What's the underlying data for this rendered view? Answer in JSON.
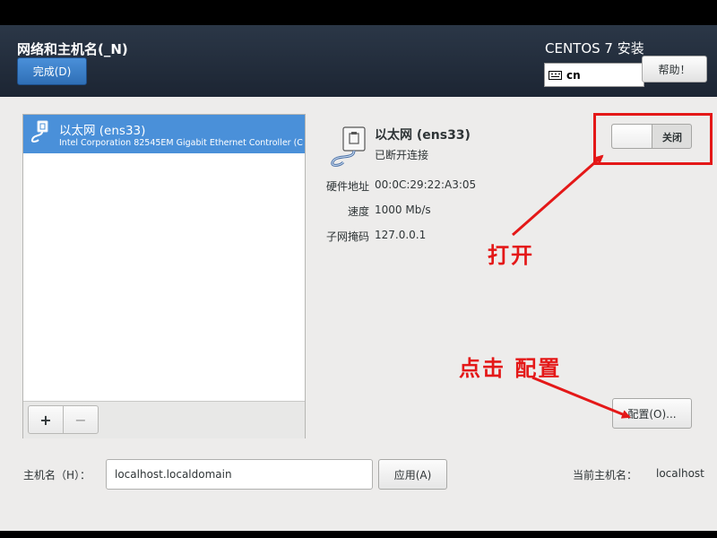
{
  "header": {
    "title": "网络和主机名(_N)",
    "done_label": "完成(D)",
    "installer_title": "CENTOS 7 安装",
    "keyboard_layout": "cn",
    "help_label": "帮助！"
  },
  "connections": {
    "items": [
      {
        "name": "以太网 (ens33)",
        "description": "Intel Corporation 82545EM Gigabit Ethernet Controller (C",
        "selected": true
      }
    ],
    "add_label": "+",
    "remove_label": "−"
  },
  "detail": {
    "name": "以太网 (ens33)",
    "status": "已断开连接",
    "properties": [
      {
        "label": "硬件地址",
        "value": "00:0C:29:22:A3:05"
      },
      {
        "label": "速度",
        "value": "1000 Mb/s"
      },
      {
        "label": "子网掩码",
        "value": "127.0.0.1"
      }
    ],
    "toggle_label": "关闭",
    "toggle_on": false,
    "configure_label": "配置(O)..."
  },
  "hostname": {
    "label": "主机名（H）：",
    "value": "localhost.localdomain",
    "apply_label": "应用(A)",
    "current_label": "当前主机名：",
    "current_value": "localhost"
  },
  "annotations": {
    "open_text": "打开",
    "click_configure_text": "点击 配置",
    "color": "#e41818"
  },
  "colors": {
    "header_bg": "#1c2533",
    "accent": "#4a90d9",
    "content_bg": "#edeceb"
  },
  "icons": [
    "keyboard-icon",
    "ethernet-icon",
    "plus-icon",
    "minus-icon",
    "arrow-icon"
  ]
}
